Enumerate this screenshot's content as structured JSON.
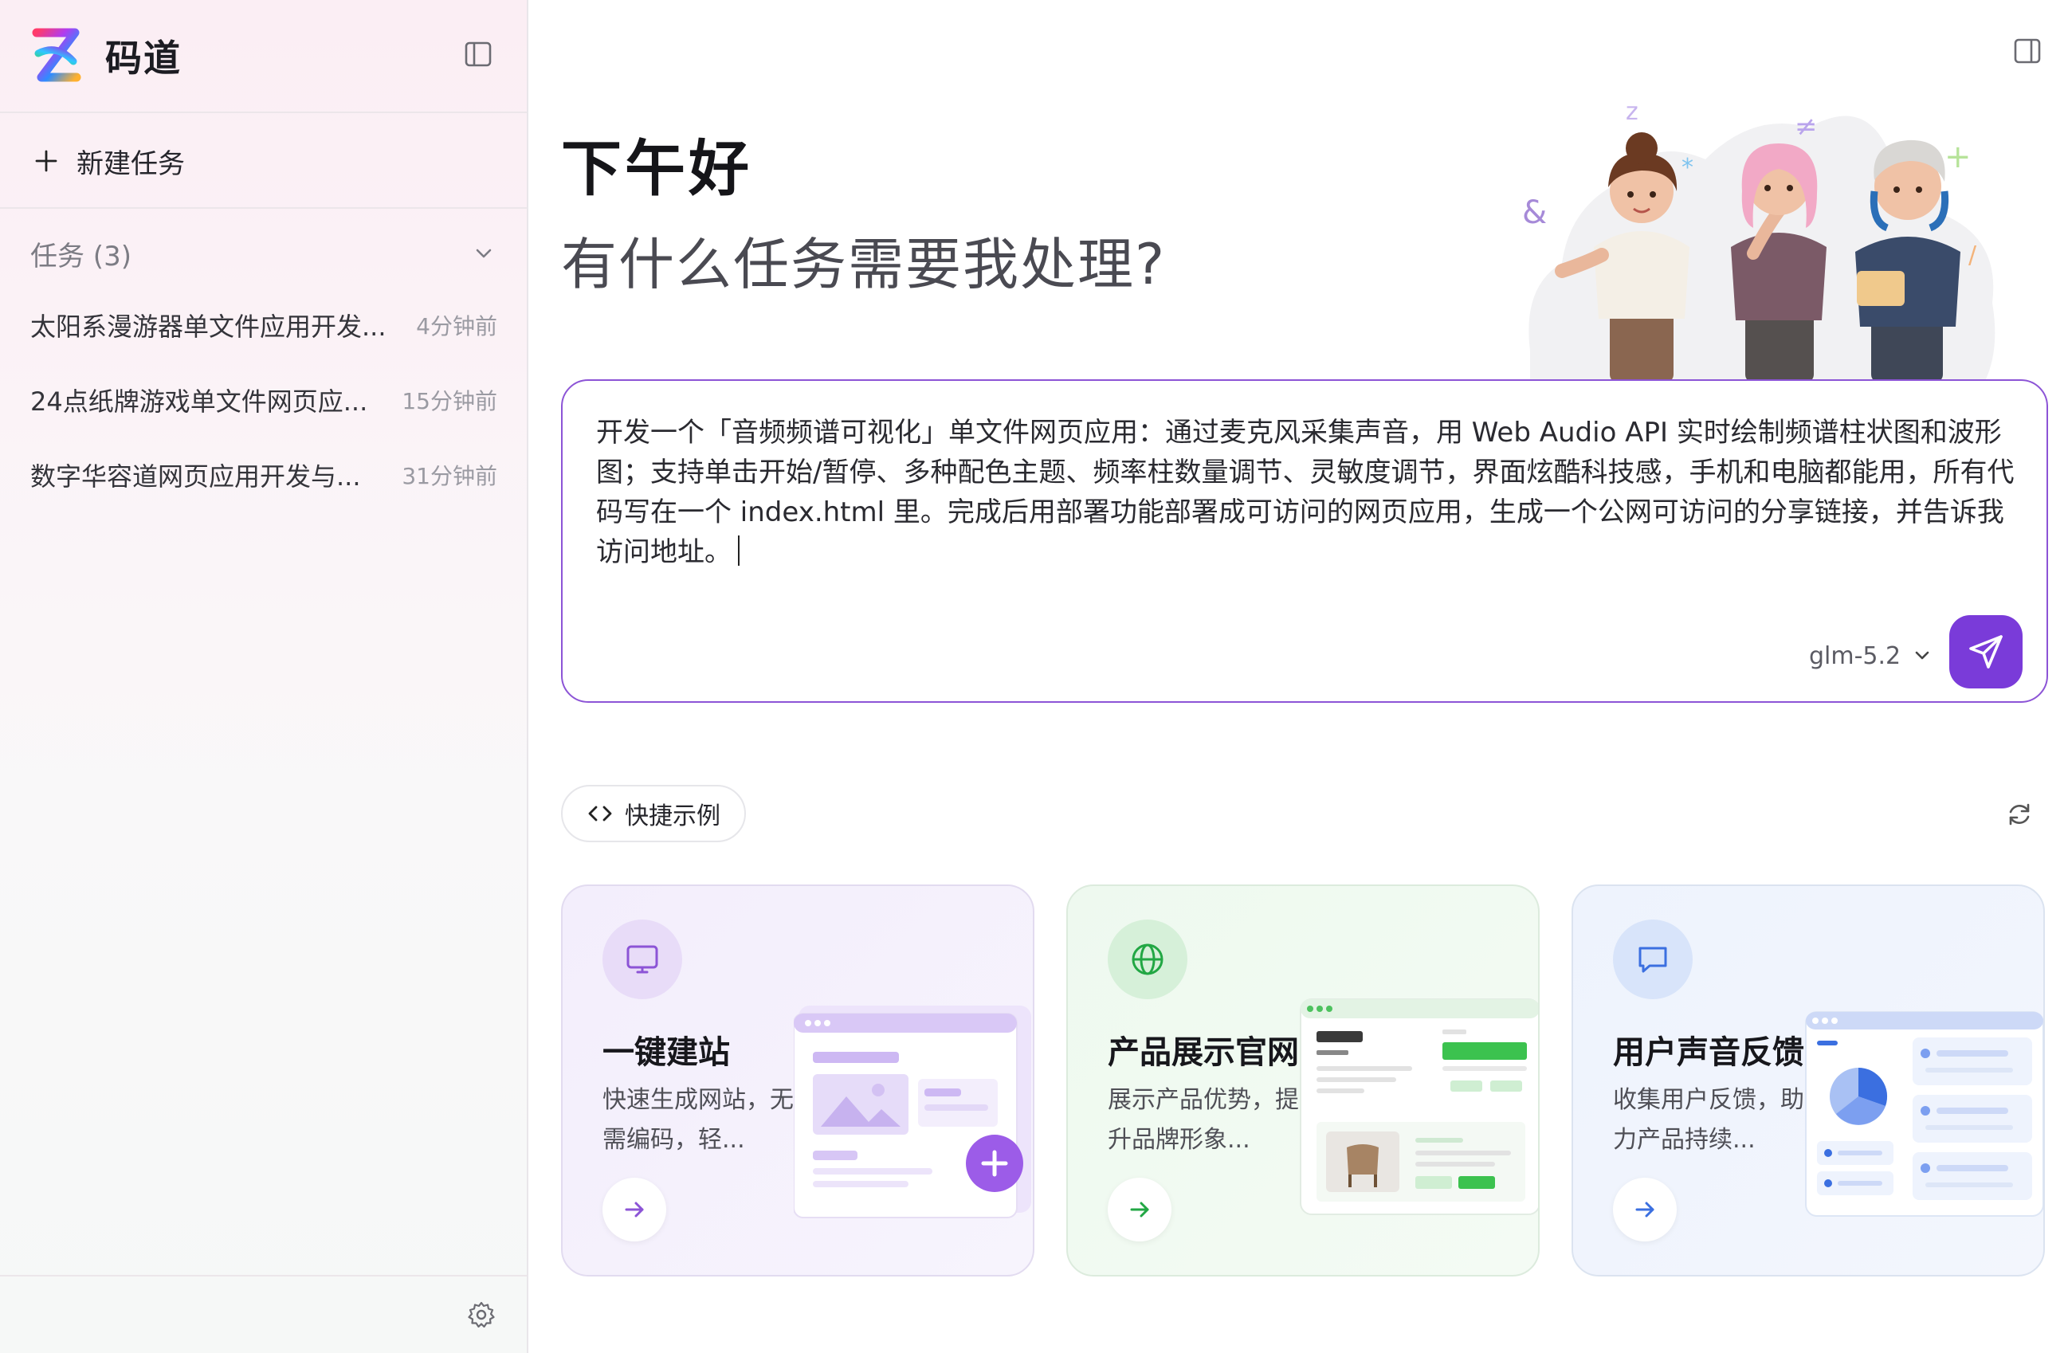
{
  "brand": {
    "name": "码道"
  },
  "sidebar": {
    "new_task_label": "新建任务",
    "tasks_header": "任务 (3)",
    "tasks": [
      {
        "title": "太阳系漫游器单文件应用开发...",
        "time": "4分钟前"
      },
      {
        "title": "24点纸牌游戏单文件网页应...",
        "time": "15分钟前"
      },
      {
        "title": "数字华容道网页应用开发与...",
        "time": "31分钟前"
      }
    ]
  },
  "main": {
    "greeting": "下午好",
    "subgreeting": "有什么任务需要我处理?",
    "prompt": {
      "text": "开发一个「音频频谱可视化」单文件网页应用：通过麦克风采集声音，用 Web Audio API 实时绘制频谱柱状图和波形图；支持单击开始/暂停、多种配色主题、频率柱数量调节、灵敏度调节，界面炫酷科技感，手机和电脑都能用，所有代码写在一个 index.html 里。完成后用部署功能部署成可访问的网页应用，生成一个公网可访问的分享链接，并告诉我访问地址。",
      "model": "glm-5.2"
    },
    "quick_examples_label": "快捷示例",
    "cards": [
      {
        "title": "一键建站",
        "desc": "快速生成网站，无需编码，轻...",
        "icon": "monitor-icon",
        "accent": "#8c54d6"
      },
      {
        "title": "产品展示官网",
        "desc": "展示产品优势，提升品牌形象...",
        "icon": "globe-icon",
        "accent": "#22a744"
      },
      {
        "title": "用户声音反馈",
        "desc": "收集用户反馈，助力产品持续...",
        "icon": "message-icon",
        "accent": "#3b6fe0"
      }
    ]
  },
  "colors": {
    "accent": "#7a3bd9",
    "border": "#8c54d6"
  }
}
